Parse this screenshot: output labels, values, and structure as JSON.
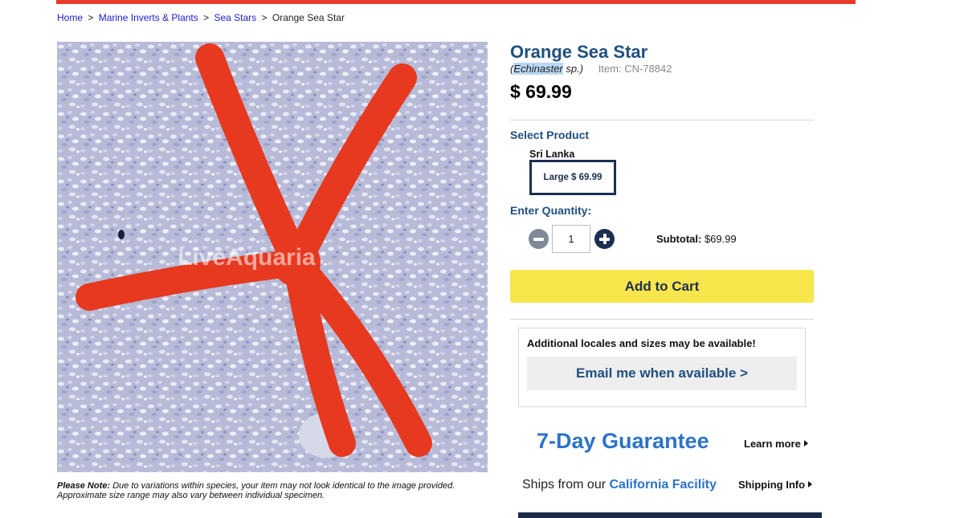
{
  "colors": {
    "brand_red": "#e8392a",
    "title_blue": "#1f4f7f",
    "navy": "#1b2f52",
    "cart_yellow": "#f9e54c",
    "accent_blue": "#2b73c8"
  },
  "breadcrumb": {
    "items": [
      "Home",
      "Marine Inverts & Plants",
      "Sea Stars",
      "Orange Sea Star"
    ],
    "separator": ">"
  },
  "product": {
    "image_watermark": "LiveAquaria",
    "title": "Orange Sea Star",
    "scientific_genus": "Echinaster",
    "scientific_suffix": "sp.)",
    "scientific_open": "(",
    "item_label": "Item: CN-78842",
    "price": "$ 69.99"
  },
  "note": {
    "label": "Please Note:",
    "text": "Due to variations within species, your item may not look identical to the image provided. Approximate size range may also vary between individual specimen."
  },
  "select_product": {
    "label": "Select Product",
    "locale": "Sri Lanka",
    "option": "Large $ 69.99"
  },
  "quantity": {
    "label": "Enter Quantity:",
    "value": "1",
    "minus_icon": "minus-circle-icon",
    "plus_icon": "plus-circle-icon",
    "subtotal_label": "Subtotal:",
    "subtotal_value": "$69.99"
  },
  "cart": {
    "add_label": "Add to Cart"
  },
  "availability": {
    "text": "Additional locales and sizes may be available!",
    "email_label": "Email me when available >"
  },
  "guarantee": {
    "title": "7-Day Guarantee",
    "learn_more": "Learn more"
  },
  "shipping": {
    "text": "Ships from our",
    "facility": "California Facility",
    "info": "Shipping Info"
  }
}
